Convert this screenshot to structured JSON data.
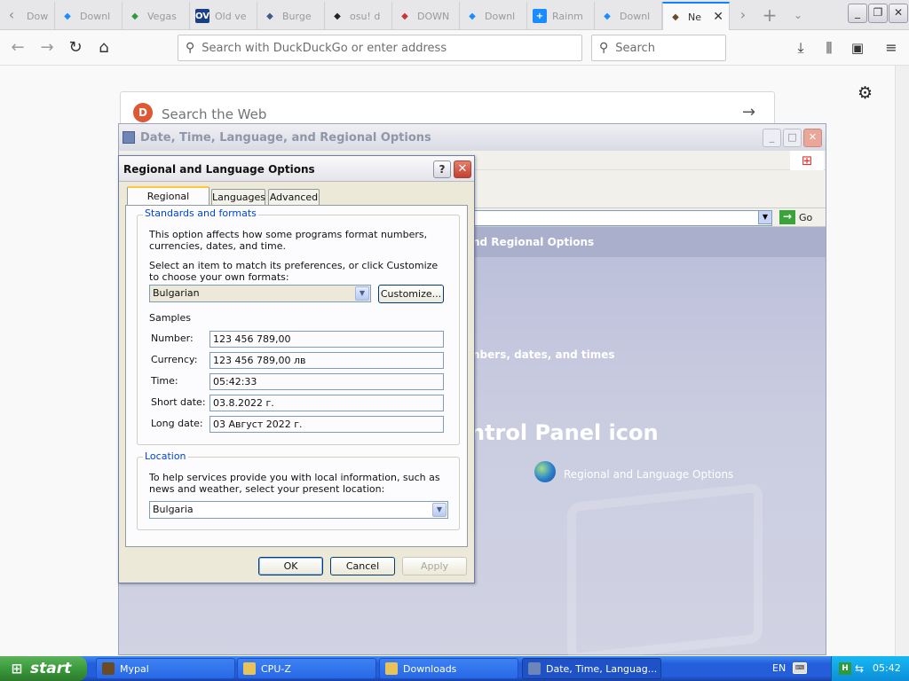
{
  "browser": {
    "tabs": [
      {
        "title": "Downl",
        "icon": "download-icon",
        "color": "#6b7a8f"
      },
      {
        "title": "Downl",
        "icon": "loading-icon",
        "color": "#1a8cff"
      },
      {
        "title": "Vegas",
        "icon": "v-check-icon",
        "color": "#2f9a3c"
      },
      {
        "title": "Old ve",
        "icon": "ov-icon",
        "color": "#1b3f85",
        "icon_text": "OV"
      },
      {
        "title": "Burge",
        "icon": "globe-icon",
        "color": "#415a86"
      },
      {
        "title": "osu! d",
        "icon": "building-icon",
        "color": "#222222"
      },
      {
        "title": "DOWN",
        "icon": "download-icon",
        "color": "#cc3333"
      },
      {
        "title": "Downl",
        "icon": "diamond-icon",
        "color": "#1a8cff"
      },
      {
        "title": "Rainm",
        "icon": "plus-icon",
        "color": "#1a8cff",
        "icon_text": "+"
      },
      {
        "title": "Downl",
        "icon": "diamond-icon",
        "color": "#1a8cff"
      },
      {
        "title": "Ne",
        "icon": "bird-icon",
        "color": "#6b4b22",
        "active": true
      }
    ],
    "url_placeholder": "Search with DuckDuckGo or enter address",
    "search_placeholder": "Search",
    "newtab_search": "Search the Web"
  },
  "control_panel": {
    "title": "Date, Time, Language, and Regional Options",
    "go_label": "Go",
    "header_text": "nd Regional Options",
    "task_text": "nbers, dates, and times",
    "big_text": "ntrol Panel icon",
    "link_text": "Regional and Language Options"
  },
  "dialog": {
    "title": "Regional and Language Options",
    "help_label": "?",
    "close_label": "✕",
    "tabs": [
      "Regional Options",
      "Languages",
      "Advanced"
    ],
    "standards_group": "Standards and formats",
    "standards_desc": "This option affects how some programs format numbers, currencies, dates, and time.",
    "select_desc": "Select an item to match its preferences, or click Customize to choose your own formats:",
    "format_value": "Bulgarian",
    "customize_label": "Customize...",
    "samples_label": "Samples",
    "samples": [
      {
        "label": "Number:",
        "value": "123 456 789,00"
      },
      {
        "label": "Currency:",
        "value": "123 456 789,00 лв"
      },
      {
        "label": "Time:",
        "value": "05:42:33"
      },
      {
        "label": "Short date:",
        "value": "03.8.2022 г."
      },
      {
        "label": "Long date:",
        "value": "03 Август 2022 г."
      }
    ],
    "location_group": "Location",
    "location_desc": "To help services provide you with local information, such as news and weather, select your present location:",
    "location_value": "Bulgaria",
    "ok_label": "OK",
    "cancel_label": "Cancel",
    "apply_label": "Apply"
  },
  "taskbar": {
    "start_label": "start",
    "tasks": [
      {
        "label": "Mypal",
        "color": "#6b4b22"
      },
      {
        "label": "CPU-Z",
        "color": "#e8c35a"
      },
      {
        "label": "Downloads",
        "color": "#e8c35a"
      },
      {
        "label": "Date, Time, Languag...",
        "color": "#6e86b7",
        "active": true
      }
    ],
    "language": "EN",
    "clock": "05:42"
  }
}
